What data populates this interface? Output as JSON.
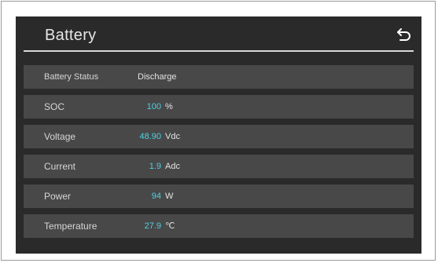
{
  "header": {
    "title": "Battery",
    "back_icon": "return-arrow-icon"
  },
  "rows": [
    {
      "label": "Battery Status",
      "value": "Discharge"
    },
    {
      "label": "SOC",
      "value": "100",
      "unit": "%"
    },
    {
      "label": "Voltage",
      "value": "48.90",
      "unit": "Vdc"
    },
    {
      "label": "Current",
      "value": "1.9",
      "unit": "Adc"
    },
    {
      "label": "Power",
      "value": "94",
      "unit": "W"
    },
    {
      "label": "Temperature",
      "value": "27.9",
      "unit": "℃"
    }
  ],
  "colors": {
    "panel": "#2a2a2a",
    "row": "#484848",
    "value_accent": "#4fd0e2"
  }
}
